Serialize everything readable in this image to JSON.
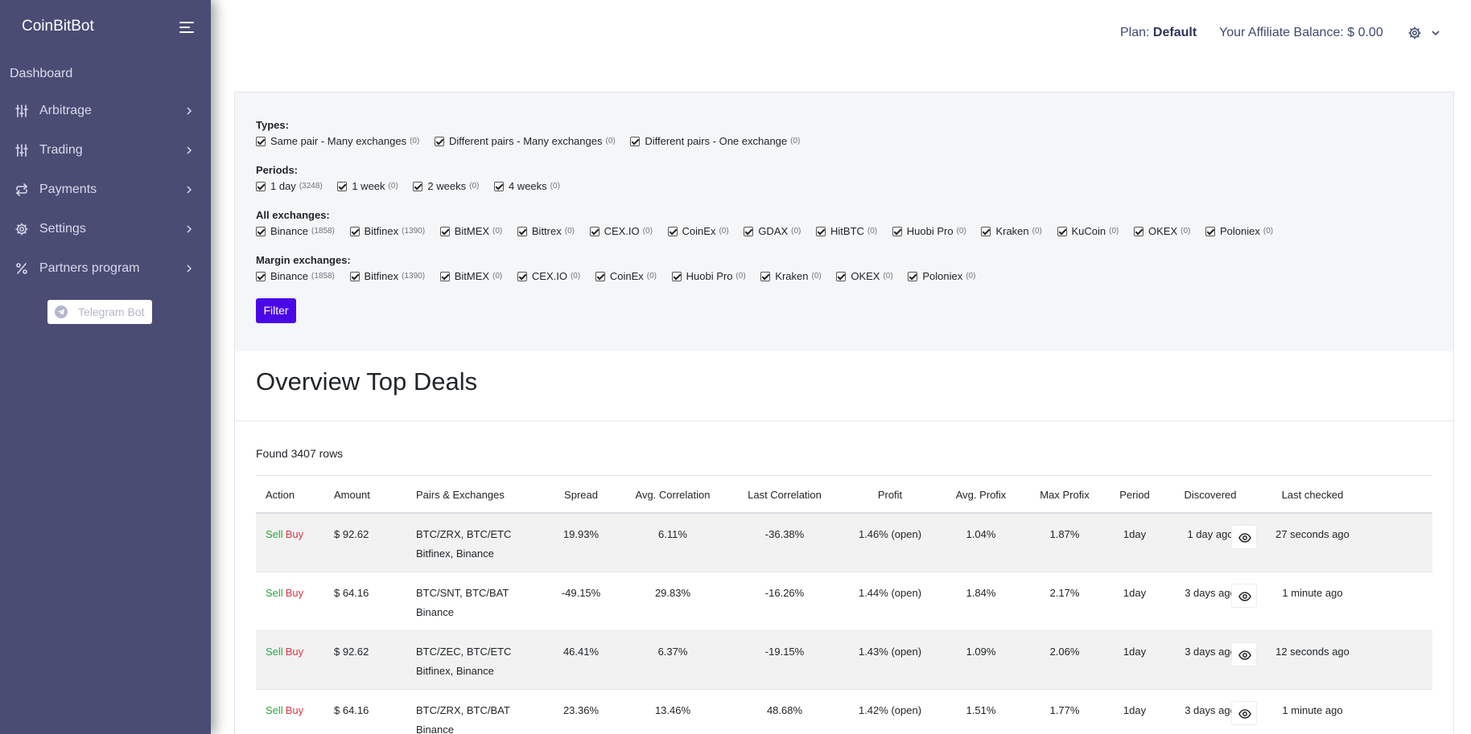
{
  "sidebar": {
    "brand": "CoinBitBot",
    "dashboard": "Dashboard",
    "items": [
      {
        "label": "Arbitrage",
        "icon": "sliders-icon"
      },
      {
        "label": "Trading",
        "icon": "sliders-icon"
      },
      {
        "label": "Payments",
        "icon": "exchange-arrows-icon"
      },
      {
        "label": "Settings",
        "icon": "gear-icon"
      },
      {
        "label": "Partners program",
        "icon": "percent-icon"
      }
    ],
    "telegram_label": "Telegram Bot"
  },
  "header": {
    "plan_prefix": "Plan: ",
    "plan_value": "Default",
    "balance": "Your Affiliate Balance: $ 0.00"
  },
  "filters": {
    "types_title": "Types:",
    "types": [
      {
        "label": "Same pair - Many exchanges",
        "count": "(0)"
      },
      {
        "label": "Different pairs - Many exchanges",
        "count": "(0)"
      },
      {
        "label": "Different pairs - One exchange",
        "count": "(0)"
      }
    ],
    "periods_title": "Periods:",
    "periods": [
      {
        "label": "1 day",
        "count": "(3248)"
      },
      {
        "label": "1 week",
        "count": "(0)"
      },
      {
        "label": "2 weeks",
        "count": "(0)"
      },
      {
        "label": "4 weeks",
        "count": "(0)"
      }
    ],
    "all_title": "All exchanges:",
    "all_exchanges": [
      {
        "label": "Binance",
        "count": "(1858)"
      },
      {
        "label": "Bitfinex",
        "count": "(1390)"
      },
      {
        "label": "BitMEX",
        "count": "(0)"
      },
      {
        "label": "Bittrex",
        "count": "(0)"
      },
      {
        "label": "CEX.IO",
        "count": "(0)"
      },
      {
        "label": "CoinEx",
        "count": "(0)"
      },
      {
        "label": "GDAX",
        "count": "(0)"
      },
      {
        "label": "HitBTC",
        "count": "(0)"
      },
      {
        "label": "Huobi Pro",
        "count": "(0)"
      },
      {
        "label": "Kraken",
        "count": "(0)"
      },
      {
        "label": "KuCoin",
        "count": "(0)"
      },
      {
        "label": "OKEX",
        "count": "(0)"
      },
      {
        "label": "Poloniex",
        "count": "(0)"
      }
    ],
    "margin_title": "Margin exchanges:",
    "margin_exchanges": [
      {
        "label": "Binance",
        "count": "(1858)"
      },
      {
        "label": "Bitfinex",
        "count": "(1390)"
      },
      {
        "label": "BitMEX",
        "count": "(0)"
      },
      {
        "label": "CEX.IO",
        "count": "(0)"
      },
      {
        "label": "CoinEx",
        "count": "(0)"
      },
      {
        "label": "Huobi Pro",
        "count": "(0)"
      },
      {
        "label": "Kraken",
        "count": "(0)"
      },
      {
        "label": "OKEX",
        "count": "(0)"
      },
      {
        "label": "Poloniex",
        "count": "(0)"
      }
    ],
    "filter_button": "Filter"
  },
  "overview": {
    "title": "Overview Top Deals",
    "found": "Found 3407 rows"
  },
  "table": {
    "headers": {
      "action": "Action",
      "amount": "Amount",
      "pairs": "Pairs & Exchanges",
      "spread": "Spread",
      "avg_corr": "Avg. Correlation",
      "last_corr": "Last Correlation",
      "profit": "Profit",
      "avg_profix": "Avg. Profix",
      "max_profix": "Max Profix",
      "period": "Period",
      "discovered": "Discovered",
      "last_checked": "Last checked"
    },
    "sell_label": "Sell",
    "buy_label": "Buy",
    "rows": [
      {
        "amount": "$ 92.62",
        "pairs": "BTC/ZRX, BTC/ETC",
        "exchanges": "Bitfinex, Binance",
        "spread": "19.93%",
        "avg_corr": "6.11%",
        "last_corr": "-36.38%",
        "profit": "1.46% (open)",
        "avg_profix": "1.04%",
        "max_profix": "1.87%",
        "period": "1day",
        "discovered": "1 day ago",
        "last_checked": "27 seconds ago"
      },
      {
        "amount": "$ 64.16",
        "pairs": "BTC/SNT, BTC/BAT",
        "exchanges": "Binance",
        "spread": "-49.15%",
        "avg_corr": "29.83%",
        "last_corr": "-16.26%",
        "profit": "1.44% (open)",
        "avg_profix": "1.84%",
        "max_profix": "2.17%",
        "period": "1day",
        "discovered": "3 days ago",
        "last_checked": "1 minute ago"
      },
      {
        "amount": "$ 92.62",
        "pairs": "BTC/ZEC, BTC/ETC",
        "exchanges": "Bitfinex, Binance",
        "spread": "46.41%",
        "avg_corr": "6.37%",
        "last_corr": "-19.15%",
        "profit": "1.43% (open)",
        "avg_profix": "1.09%",
        "max_profix": "2.06%",
        "period": "1day",
        "discovered": "3 days ago",
        "last_checked": "12 seconds ago"
      },
      {
        "amount": "$ 64.16",
        "pairs": "BTC/ZRX, BTC/BAT",
        "exchanges": "Binance",
        "spread": "23.36%",
        "avg_corr": "13.46%",
        "last_corr": "48.68%",
        "profit": "1.42% (open)",
        "avg_profix": "1.51%",
        "max_profix": "1.77%",
        "period": "1day",
        "discovered": "3 days ago",
        "last_checked": "1 minute ago"
      }
    ]
  }
}
